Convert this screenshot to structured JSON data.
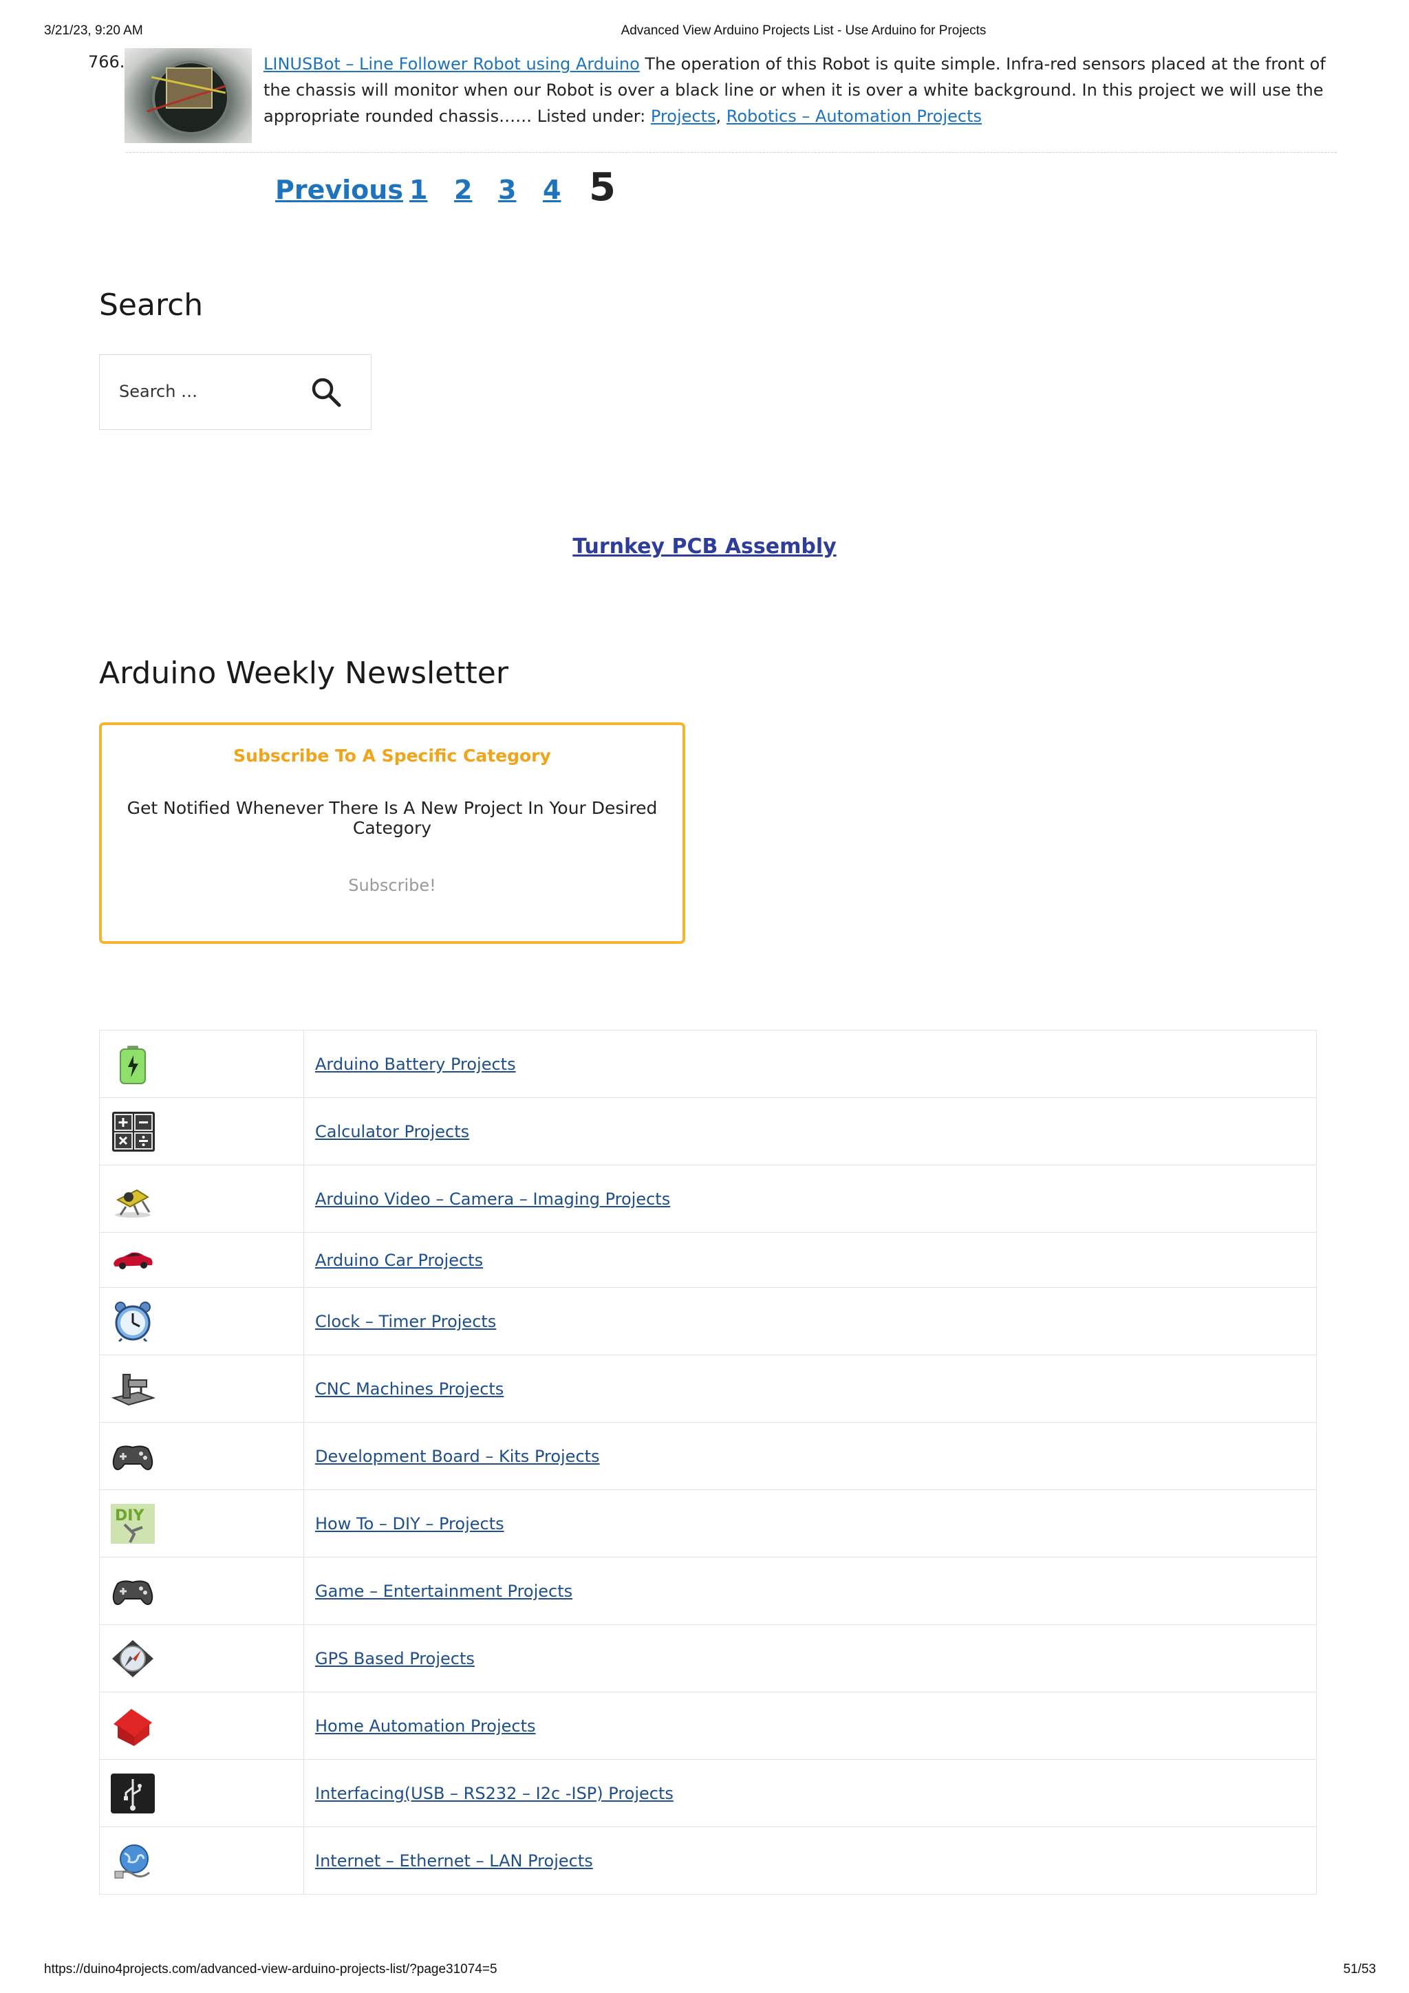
{
  "print_header": {
    "datetime": "3/21/23, 9:20 AM",
    "page_title": "Advanced View Arduino Projects List - Use Arduino for Projects"
  },
  "entry": {
    "number": "766.",
    "title": "LINUSBot – Line Follower Robot using Arduino",
    "description": " The operation of this Robot is quite simple. Infra-red sensors placed at the front of the chassis  will monitor when our Robot is over a black line or when it is over a white background. In this project we will use the appropriate rounded chassis…… Listed under: ",
    "categories": [
      "Projects",
      "Robotics – Automation Projects"
    ],
    "category_separator": ", "
  },
  "pagination": {
    "previous": "Previous",
    "pages": [
      "1",
      "2",
      "3",
      "4"
    ],
    "current": "5"
  },
  "search": {
    "title": "Search",
    "placeholder": "Search …"
  },
  "turnkey_link": "Turnkey PCB Assembly",
  "newsletter": {
    "title": "Arduino Weekly Newsletter",
    "box_title": "Subscribe To A Specific Category",
    "box_desc": "Get Notified Whenever There Is A New Project In Your Desired Category",
    "button": "Subscribe!"
  },
  "categories": [
    {
      "label": "Arduino Battery Projects",
      "icon": "battery-icon"
    },
    {
      "label": "Calculator Projects",
      "icon": "calculator-icon"
    },
    {
      "label": "Arduino Video – Camera – Imaging Projects",
      "icon": "camera-icon"
    },
    {
      "label": "Arduino Car Projects",
      "icon": "car-icon"
    },
    {
      "label": "Clock – Timer Projects",
      "icon": "alarm-clock-icon"
    },
    {
      "label": "CNC Machines Projects",
      "icon": "cnc-machine-icon"
    },
    {
      "label": "Development Board – Kits Projects",
      "icon": "gamepad-icon"
    },
    {
      "label": "How To – DIY – Projects",
      "icon": "diy-icon"
    },
    {
      "label": "Game – Entertainment Projects",
      "icon": "gamepad-icon"
    },
    {
      "label": "GPS Based Projects",
      "icon": "compass-icon"
    },
    {
      "label": "Home Automation Projects",
      "icon": "house-icon"
    },
    {
      "label": "Interfacing(USB – RS232 – I2c -ISP) Projects",
      "icon": "usb-icon"
    },
    {
      "label": "Internet – Ethernet – LAN Projects",
      "icon": "globe-network-icon"
    }
  ],
  "print_footer": {
    "url": "https://duino4projects.com/advanced-view-arduino-projects-list/?page31074=5",
    "page_count": "51/53"
  }
}
